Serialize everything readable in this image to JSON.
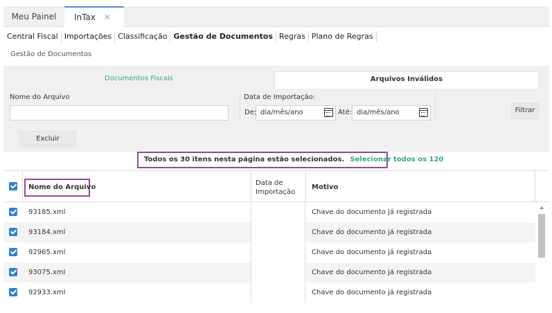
{
  "top_tabs": [
    {
      "label": "Meu Painel"
    },
    {
      "label": "InTax",
      "close": "✕"
    }
  ],
  "menu": [
    "Central Fiscal",
    "Importações",
    "Classificação",
    "Gestão de Documentos",
    "Regras",
    "Plano de Regras"
  ],
  "breadcrumb": "Gestão de Documentos",
  "panel": {
    "tabs": [
      "Documentos Fiscais",
      "Arquivos Inválidos"
    ],
    "filename_label": "Nome do Arquivo",
    "filename_value": "",
    "import_date_label": "Data de Importação:",
    "from_label": "De:",
    "to_label": "Até:",
    "date_placeholder": "dia/mês/ano",
    "filter_button": "Filtrar",
    "delete_button": "Excluir"
  },
  "selection": {
    "text": "Todos os 30 itens nesta página estão selecionados.",
    "link": "Selecionar todos os 120"
  },
  "table": {
    "headers": [
      "Nome do Arquivo",
      "Data de Importação",
      "Motivo"
    ],
    "rows": [
      {
        "file": "93185.xml",
        "date": "",
        "reason": "Chave do documento já registrada"
      },
      {
        "file": "93184.xml",
        "date": "",
        "reason": "Chave do documento já registrada"
      },
      {
        "file": "92965.xml",
        "date": "",
        "reason": "Chave do documento já registrada"
      },
      {
        "file": "93075.xml",
        "date": "",
        "reason": "Chave do documento já registrada"
      },
      {
        "file": "92933.xml",
        "date": "",
        "reason": "Chave do documento já registrada"
      }
    ]
  },
  "colors": {
    "accent_green": "#3aa776",
    "highlight_purple": "#8e4a9e",
    "checkbox_blue": "#2f7fd4",
    "tab_blue": "#4a90d9"
  }
}
